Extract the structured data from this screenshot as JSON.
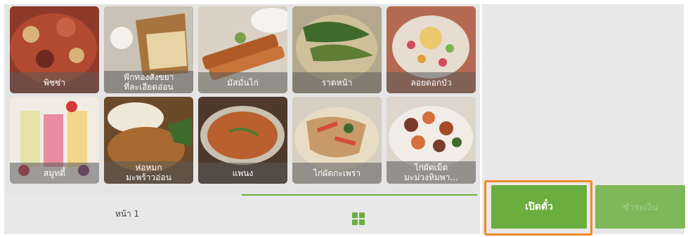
{
  "menu": {
    "items": [
      {
        "label": "พิซซ่า",
        "bg": "#8e3a2a",
        "accent": "#d8b27a"
      },
      {
        "label": "ฟักทองสังขยา\nที่ละเอียดอ่อน",
        "bg": "#a8743d",
        "accent": "#e8d3a4"
      },
      {
        "label": "มัสมั่นไก่",
        "bg": "#b15a27",
        "accent": "#e1c28c"
      },
      {
        "label": "ราดหน้า",
        "bg": "#5f7d34",
        "accent": "#cfc09a"
      },
      {
        "label": "ลอยดอกบัว",
        "bg": "#b46a52",
        "accent": "#e9c96b"
      },
      {
        "label": "สมูทตี้",
        "bg": "#d8cfc1",
        "accent": "#d45b6f"
      },
      {
        "label": "ห่อหมก\nมะพร้าวอ่อน",
        "bg": "#8a5a2f",
        "accent": "#efe7d8"
      },
      {
        "label": "แพนง",
        "bg": "#a9542c",
        "accent": "#e5a85a"
      },
      {
        "label": "ไก่ผัดกะเพรา",
        "bg": "#7d6b49",
        "accent": "#d54b3a"
      },
      {
        "label": "ไก่ผัดเม็ด\nมะม่วงหิมพา...",
        "bg": "#7c3a2a",
        "accent": "#d66f3c"
      }
    ]
  },
  "pagination": {
    "page_label": "หน้า 1"
  },
  "actions": {
    "open_ticket_label": "เปิดตั๋ว",
    "pay_label": "ชำระเงิน"
  },
  "colors": {
    "accent_green": "#6cad3f",
    "highlight_orange": "#f08a24"
  }
}
